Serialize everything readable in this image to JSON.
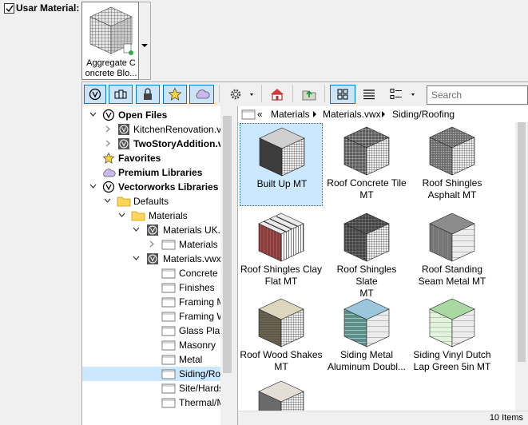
{
  "use_material": {
    "label": "Usar Material:",
    "checked": true
  },
  "material_button": {
    "line1": "Aggregate C",
    "line2": "oncrete Blo..."
  },
  "toolbar": {
    "search_placeholder": "Search"
  },
  "tree": {
    "open_files": "Open Files",
    "file1": "KitchenRenovation.vwx",
    "file2": "TwoStoryAddition.vwx",
    "favorites": "Favorites",
    "premium": "Premium Libraries",
    "vw_libraries": "Vectorworks Libraries",
    "defaults": "Defaults",
    "materials": "Materials",
    "materials_uk": "Materials UK.vwx",
    "materials_sub": "Materials",
    "materials_vwx": "Materials.vwx",
    "folders": [
      "Concrete",
      "Finishes",
      "Framing Members",
      "Framing Wood",
      "Glass Plastic",
      "Masonry",
      "Metal",
      "Siding/Roofing",
      "Site/Hardscape",
      "Thermal/Moisture"
    ]
  },
  "breadcrumb": {
    "back": "«",
    "c1": "Materials",
    "c2": "Materials.vwx",
    "c3": "Siding/Roofing"
  },
  "items": [
    {
      "l1": "Built Up MT",
      "l2": ""
    },
    {
      "l1": "Roof Concrete Tile",
      "l2": "MT"
    },
    {
      "l1": "Roof Shingles",
      "l2": "Asphalt MT"
    },
    {
      "l1": "Roof Shingles Clay",
      "l2": "Flat MT"
    },
    {
      "l1": "Roof Shingles Slate",
      "l2": "MT"
    },
    {
      "l1": "Roof Standing",
      "l2": "Seam Metal MT"
    },
    {
      "l1": "Roof Wood Shakes",
      "l2": "MT"
    },
    {
      "l1": "Siding Metal",
      "l2": "Aluminum Doubl..."
    },
    {
      "l1": "Siding Vinyl Dutch",
      "l2": "Lap Green 5in MT"
    }
  ],
  "status": {
    "count": "10 Items"
  },
  "colors": {
    "accent": "#0078d7",
    "selection": "#cce8ff"
  }
}
